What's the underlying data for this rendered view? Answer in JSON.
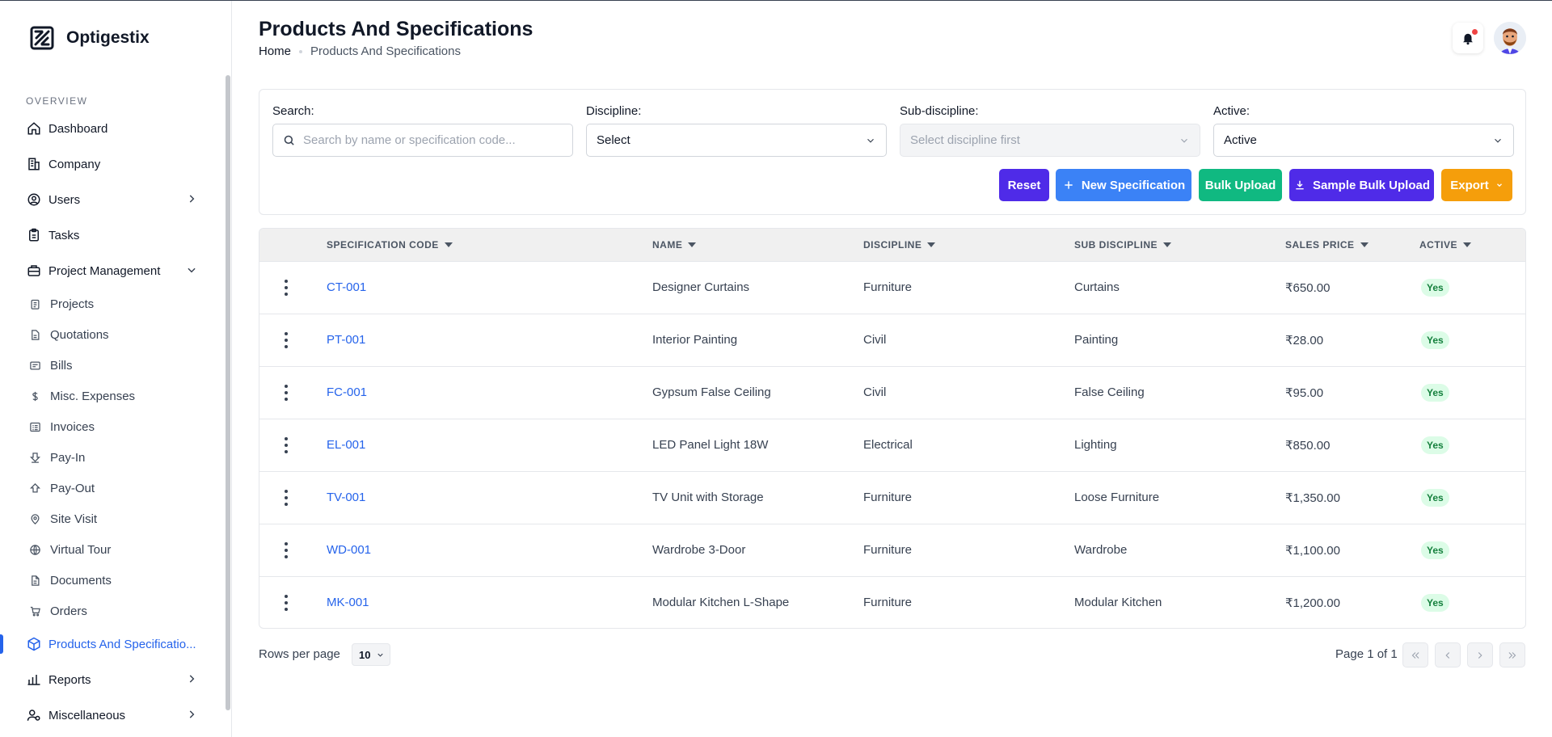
{
  "brand": {
    "name": "Optigestix"
  },
  "sidebar": {
    "section_label": "OVERVIEW",
    "items": [
      {
        "label": "Dashboard",
        "icon": "home-icon"
      },
      {
        "label": "Company",
        "icon": "building-icon"
      },
      {
        "label": "Users",
        "icon": "user-circle-icon",
        "chevron": "right"
      },
      {
        "label": "Tasks",
        "icon": "clipboard-icon"
      },
      {
        "label": "Project Management",
        "icon": "briefcase-icon",
        "chevron": "down"
      }
    ],
    "sub_items": [
      {
        "label": "Projects",
        "icon": "clipboard-list-icon"
      },
      {
        "label": "Quotations",
        "icon": "file-icon"
      },
      {
        "label": "Bills",
        "icon": "receipt-icon"
      },
      {
        "label": "Misc. Expenses",
        "icon": "dollar-icon"
      },
      {
        "label": "Invoices",
        "icon": "invoice-list-icon"
      },
      {
        "label": "Pay-In",
        "icon": "arrow-down-box-icon"
      },
      {
        "label": "Pay-Out",
        "icon": "arrow-up-box-icon"
      },
      {
        "label": "Site Visit",
        "icon": "map-pin-icon"
      },
      {
        "label": "Virtual Tour",
        "icon": "globe-icon"
      },
      {
        "label": "Documents",
        "icon": "document-icon"
      },
      {
        "label": "Orders",
        "icon": "cart-icon"
      }
    ],
    "bottom_items": [
      {
        "label": "Products And Specificatio...",
        "icon": "box-icon",
        "active": true
      },
      {
        "label": "Reports",
        "icon": "bar-chart-icon",
        "chevron": "right"
      },
      {
        "label": "Miscellaneous",
        "icon": "users-settings-icon",
        "chevron": "right"
      }
    ]
  },
  "header": {
    "title": "Products And Specifications",
    "breadcrumb": {
      "home": "Home",
      "current": "Products And Specifications"
    }
  },
  "filters": {
    "search": {
      "label": "Search:",
      "placeholder": "Search by name or specification code..."
    },
    "discipline": {
      "label": "Discipline:",
      "value": "Select"
    },
    "sub_discipline": {
      "label": "Sub-discipline:",
      "value": "Select discipline first"
    },
    "active": {
      "label": "Active:",
      "value": "Active"
    }
  },
  "actions": {
    "reset": "Reset",
    "new_spec": "New Specification",
    "bulk_upload": "Bulk Upload",
    "sample_bulk_upload": "Sample Bulk Upload",
    "export": "Export"
  },
  "colors": {
    "reset": "#4f2be8",
    "new_spec": "#3b82f6",
    "bulk_upload": "#10b981",
    "sample_bulk_upload": "#4f2be8",
    "export": "#f59e0b",
    "link": "#2563eb"
  },
  "table": {
    "columns": [
      "SPECIFICATION CODE",
      "NAME",
      "DISCIPLINE",
      "SUB DISCIPLINE",
      "SALES PRICE",
      "ACTIVE"
    ],
    "rows": [
      {
        "code": "CT-001",
        "name": "Designer Curtains",
        "discipline": "Furniture",
        "sub": "Curtains",
        "price": "₹650.00",
        "active": "Yes"
      },
      {
        "code": "PT-001",
        "name": "Interior Painting",
        "discipline": "Civil",
        "sub": "Painting",
        "price": "₹28.00",
        "active": "Yes"
      },
      {
        "code": "FC-001",
        "name": "Gypsum False Ceiling",
        "discipline": "Civil",
        "sub": "False Ceiling",
        "price": "₹95.00",
        "active": "Yes"
      },
      {
        "code": "EL-001",
        "name": "LED Panel Light 18W",
        "discipline": "Electrical",
        "sub": "Lighting",
        "price": "₹850.00",
        "active": "Yes"
      },
      {
        "code": "TV-001",
        "name": "TV Unit with Storage",
        "discipline": "Furniture",
        "sub": "Loose Furniture",
        "price": "₹1,350.00",
        "active": "Yes"
      },
      {
        "code": "WD-001",
        "name": "Wardrobe 3-Door",
        "discipline": "Furniture",
        "sub": "Wardrobe",
        "price": "₹1,100.00",
        "active": "Yes"
      },
      {
        "code": "MK-001",
        "name": "Modular Kitchen L-Shape",
        "discipline": "Furniture",
        "sub": "Modular Kitchen",
        "price": "₹1,200.00",
        "active": "Yes"
      }
    ]
  },
  "pagination": {
    "rows_per_page_label": "Rows per page",
    "rows_per_page": "10",
    "page_info": "Page 1 of 1"
  }
}
